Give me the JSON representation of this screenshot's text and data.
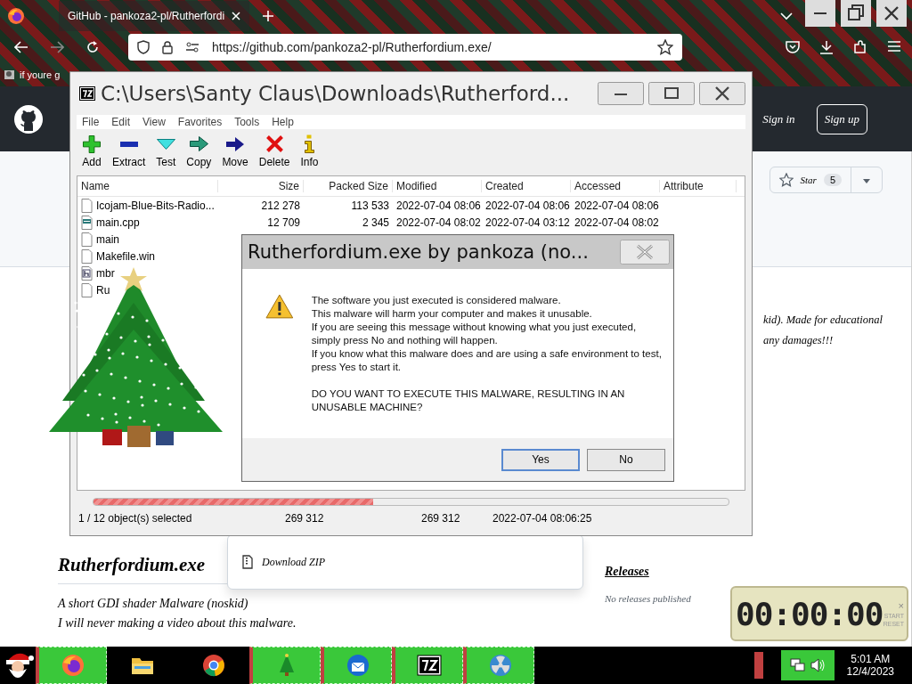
{
  "browser": {
    "tab": {
      "title": "GitHub - pankoza2-pl/Rutherfordi",
      "selected": true
    },
    "url": "https://github.com/pankoza2-pl/Rutherfordium.exe/",
    "bookmark": "if youre g"
  },
  "github": {
    "sign_in": "Sign in",
    "sign_up": "Sign up",
    "star_label": "Star",
    "star_count": "5",
    "description": [
      "kid). Made for educational",
      "any damages!!!"
    ],
    "readme_title": "Rutherfordium.exe",
    "readme_lines": [
      "A short GDI shader Malware (noskid)",
      "I will never making a video about this malware."
    ],
    "download_zip": "Download ZIP",
    "releases_title": "Releases",
    "releases_text": "No releases published"
  },
  "archiver": {
    "title": "C:\\Users\\Santy Claus\\Downloads\\Rutherford...",
    "menu": [
      "File",
      "Edit",
      "View",
      "Favorites",
      "Tools",
      "Help"
    ],
    "toolbar": [
      "Add",
      "Extract",
      "Test",
      "Copy",
      "Move",
      "Delete",
      "Info"
    ],
    "columns": [
      "Name",
      "Size",
      "Packed Size",
      "Modified",
      "Created",
      "Accessed",
      "Attribute"
    ],
    "rows": [
      {
        "kind": "file",
        "selected": false,
        "cells": [
          "Icojam-Blue-Bits-Radio...",
          "212 278",
          "113 533",
          "2022-07-04 08:06",
          "2022-07-04 08:06",
          "2022-07-04 08:06"
        ]
      },
      {
        "kind": "cpp",
        "selected": false,
        "cells": [
          "main.cpp",
          "12 709",
          "2 345",
          "2022-07-04 08:02",
          "2022-07-04 03:12",
          "2022-07-04 08:02"
        ]
      },
      {
        "kind": "file",
        "selected": false,
        "cells": [
          "main"
        ]
      },
      {
        "kind": "file",
        "selected": false,
        "cells": [
          "Makefile.win"
        ]
      },
      {
        "kind": "header",
        "selected": false,
        "cells": [
          "mbr"
        ]
      },
      {
        "kind": "file",
        "selected": false,
        "cells": [
          "Ru"
        ]
      }
    ],
    "progress": {
      "level": 0.44
    },
    "status": [
      "1 / 12 object(s) selected",
      "269 312",
      "269 312",
      "2022-07-04 08:06:25"
    ]
  },
  "dialog": {
    "title": "Rutherfordium.exe by pankoza (no...",
    "message": [
      "The software you just executed is considered malware.",
      "This malware will harm your computer and makes it unusable.",
      "If you are seeing this message without knowing what you just executed, simply press No and nothing will happen.",
      "If you know what this malware does and are using a safe environment to test, press Yes to start it."
    ],
    "question": "DO YOU WANT TO EXECUTE THIS MALWARE, RESULTING IN AN UNUSABLE MACHINE?",
    "buttons": [
      {
        "label": "Yes",
        "selected": true
      },
      {
        "label": "No",
        "selected": false
      }
    ]
  },
  "stopwatch": {
    "time": "00:00:00",
    "start": "START",
    "reset": "RESET",
    "close": "×"
  },
  "taskbar": {
    "apps": [
      {
        "running": true
      },
      {
        "running": false
      },
      {
        "running": false
      },
      {
        "running": true
      },
      {
        "running": true
      },
      {
        "running": true
      },
      {
        "running": true
      }
    ],
    "time": "5:01 AM",
    "date": "12/4/2023"
  }
}
